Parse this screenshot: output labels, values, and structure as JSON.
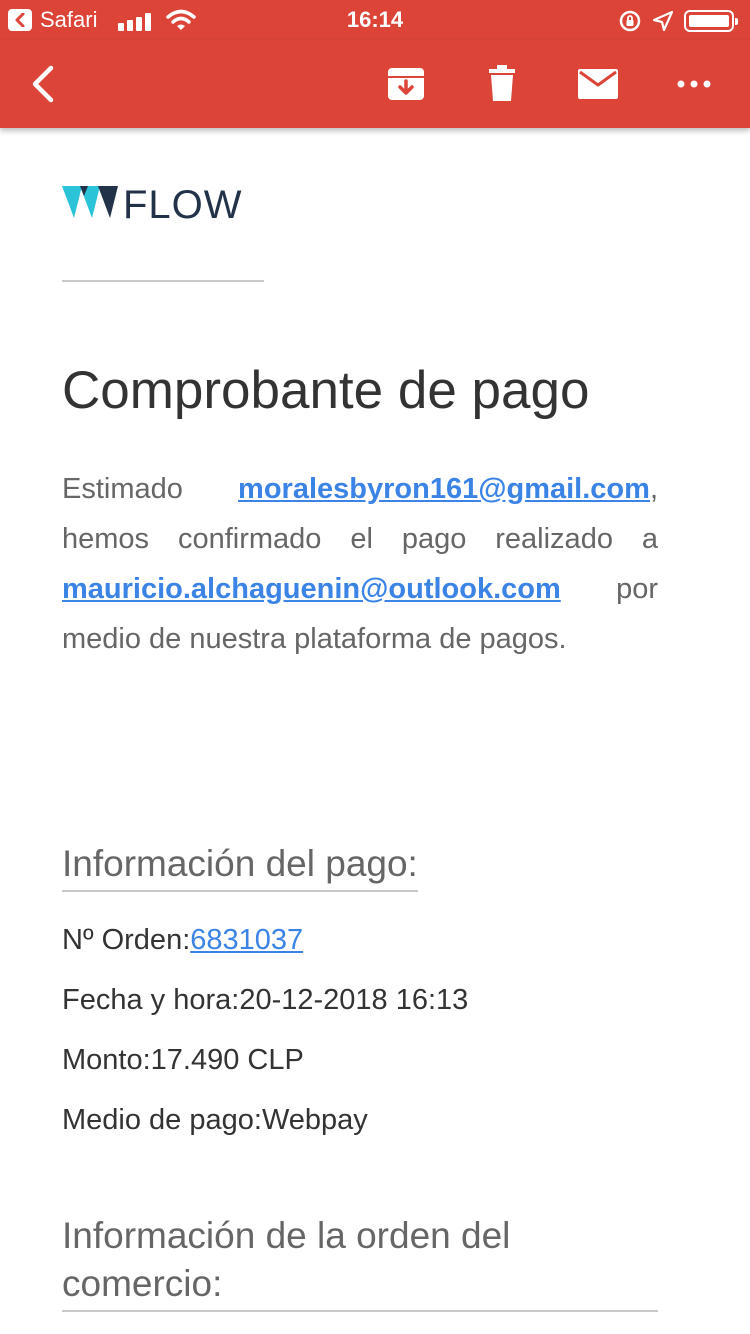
{
  "status_bar": {
    "app_name": "Safari",
    "time": "16:14"
  },
  "app_bar": {
    "actions": [
      "back",
      "archive",
      "delete",
      "mark-unread",
      "more"
    ]
  },
  "email": {
    "logo_text": "FLOW",
    "title": "Comprobante de pago",
    "intro": {
      "greeting": "Estimado ",
      "sender_email": "moralesbyron161@gmail.com",
      "text_1": ", hemos confirmado el pago realizado a ",
      "recipient_email": "mauricio.alchaguenin@outlook.com",
      "text_2": " por medio de nuestra plataforma de pagos."
    },
    "payment_info": {
      "heading": "Información del pago:",
      "order_label": "Nº Orden:",
      "order_value": "6831037",
      "date_label": "Fecha y hora:",
      "date_value": "20-12-2018 16:13",
      "amount_label": "Monto:",
      "amount_value": "17.490 CLP",
      "method_label": "Medio de pago:",
      "method_value": "Webpay"
    },
    "merchant_info": {
      "heading": "Información de la orden del comercio:"
    }
  },
  "colors": {
    "header_red": "#db4437",
    "link_blue": "#3b84e6",
    "logo_cyan": "#2bc3d8",
    "logo_navy": "#223349"
  }
}
